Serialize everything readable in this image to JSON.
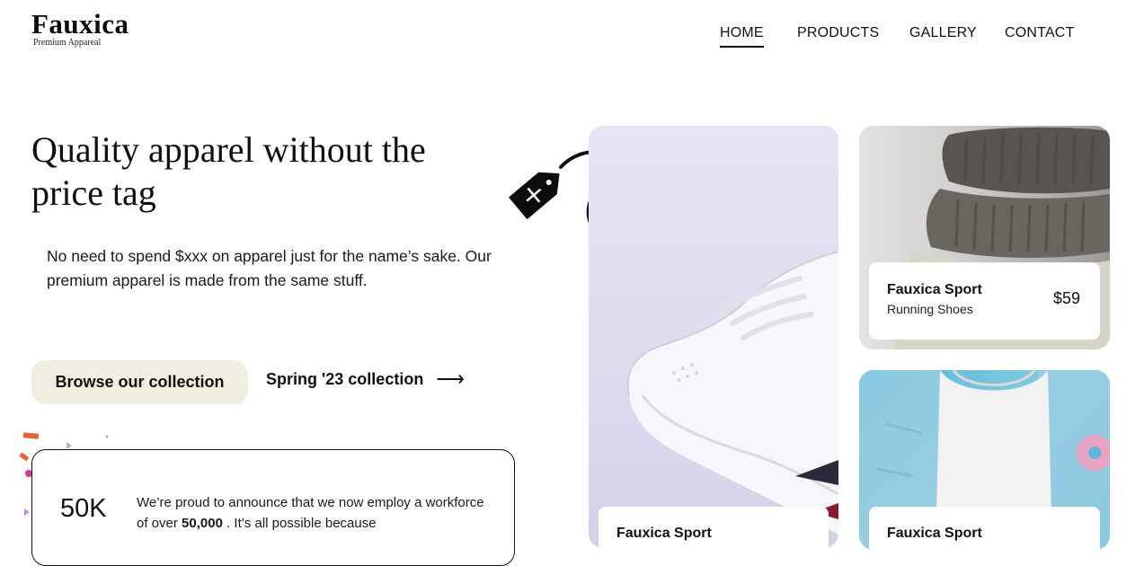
{
  "brand": {
    "name": "Fauxica",
    "tagline": "Premium Appareal"
  },
  "nav": {
    "items": [
      {
        "label": "HOME",
        "active": true
      },
      {
        "label": "PRODUCTS",
        "active": false
      },
      {
        "label": "GALLERY",
        "active": false
      },
      {
        "label": "CONTACT",
        "active": false
      }
    ]
  },
  "hero": {
    "title": "Quality apparel without the price tag",
    "description": "No need to spend $xxx on apparel just for the name’s sake. Our premium apparel is made from the same stuff.",
    "primary_button": "Browse our collection",
    "secondary_link": "Spring '23 collection",
    "secondary_link_icon": "arrow-right-icon"
  },
  "announcement": {
    "stat": "50K",
    "text_before": "We’re proud to announce that we now employ a workforce of over ",
    "text_bold": "50,000",
    "text_after": " . It’s all possible because"
  },
  "cards": {
    "shoe": {
      "name": "Fauxica Sport"
    },
    "sweater": {
      "name": "Fauxica Sport",
      "subtitle": "Running Shoes",
      "price": "$59"
    },
    "denim": {
      "name": "Fauxica Sport"
    }
  },
  "colors": {
    "button_bg": "#efeee0",
    "shoe_card_bg": "#e6e5f3",
    "denim_card_bg": "#5fb6d8"
  }
}
